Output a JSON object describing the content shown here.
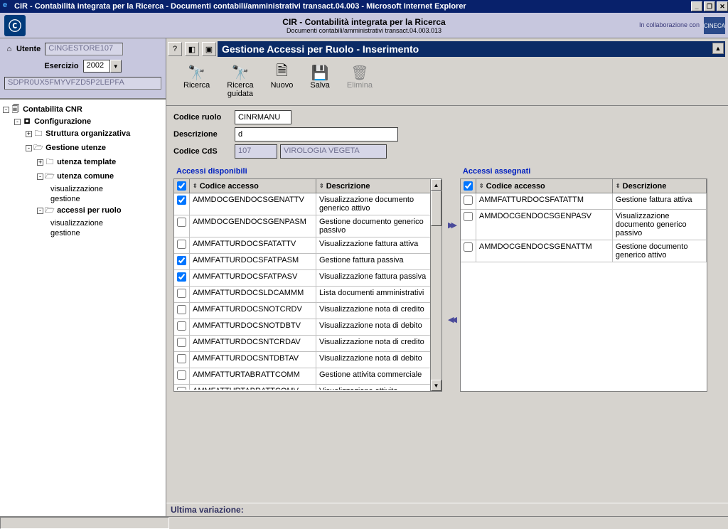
{
  "window": {
    "title": "CIR  -  Contabilità integrata per la Ricerca  -  Documenti contabili/amministrativi transact.04.003  -  Microsoft Internet Explorer"
  },
  "header": {
    "app_title": "CIR - Contabilità integrata per la Ricerca",
    "app_subtitle": "Documenti contabili/amministrativi transact.04.003.013",
    "collab": "In collaborazione con",
    "cineca": "CINECA"
  },
  "left": {
    "utente_label": "Utente",
    "utente_value": "CINGESTORE107",
    "esercizio_label": "Esercizio",
    "esercizio_value": "2002",
    "code_value": "SDPR0UX5FMYVFZD5P2LEPFA"
  },
  "tree": {
    "root": "Contabilita CNR",
    "n0": "Configurazione",
    "n01": "Struttura organizzativa",
    "n02": "Gestione utenze",
    "n021": "utenza template",
    "n022": "utenza comune",
    "n0221": "visualizzazione",
    "n0222": "gestione",
    "n023": "accessi per ruolo",
    "n0231": "visualizzazione",
    "n0232": "gestione"
  },
  "section": {
    "title": "Gestione Accessi per Ruolo - Inserimento"
  },
  "actions": {
    "ricerca": "Ricerca",
    "ricerca_guidata": "Ricerca\nguidata",
    "nuovo": "Nuovo",
    "salva": "Salva",
    "elimina": "Elimina"
  },
  "form": {
    "codice_ruolo_label": "Codice ruolo",
    "codice_ruolo_value": "CINRMANU",
    "descrizione_label": "Descrizione",
    "descrizione_value": "d",
    "codice_cds_label": "Codice CdS",
    "codice_cds_value": "107",
    "codice_cds_desc": "VIROLOGIA VEGETA"
  },
  "lists": {
    "disp_title": "Accessi disponibili",
    "asseg_title": "Accessi assegnati",
    "col_code": "Codice accesso",
    "col_desc": "Descrizione"
  },
  "disponibili": [
    {
      "chk": true,
      "code": "AMMDOCGENDOCSGENATTV",
      "desc": "Visualizzazione documento generico attivo"
    },
    {
      "chk": false,
      "code": "AMMDOCGENDOCSGENPASM",
      "desc": "Gestione documento generico passivo"
    },
    {
      "chk": false,
      "code": "AMMFATTURDOCSFATATTV",
      "desc": "Visualizzazione fattura attiva"
    },
    {
      "chk": true,
      "code": "AMMFATTURDOCSFATPASM",
      "desc": "Gestione fattura passiva"
    },
    {
      "chk": true,
      "code": "AMMFATTURDOCSFATPASV",
      "desc": "Visualizzazione fattura passiva"
    },
    {
      "chk": false,
      "code": "AMMFATTURDOCSLDCAMMM",
      "desc": "Lista documenti amministrativi"
    },
    {
      "chk": false,
      "code": "AMMFATTURDOCSNOTCRDV",
      "desc": "Visualizzazione nota di credito"
    },
    {
      "chk": false,
      "code": "AMMFATTURDOCSNOTDBTV",
      "desc": "Visualizzazione nota di debito"
    },
    {
      "chk": false,
      "code": "AMMFATTURDOCSNTCRDAV",
      "desc": "Visualizzazione nota di credito"
    },
    {
      "chk": false,
      "code": "AMMFATTURDOCSNTDBTAV",
      "desc": "Visualizzazione nota di debito"
    },
    {
      "chk": false,
      "code": "AMMFATTURTABRATTCOMM",
      "desc": "Gestione attivita commerciale"
    },
    {
      "chk": false,
      "code": "AMMFATTURTABRATTCOMV",
      "desc": "Visualizzazione attivita"
    }
  ],
  "assegnati": [
    {
      "chk": false,
      "code": "AMMFATTURDOCSFATATTM",
      "desc": "Gestione fattura attiva"
    },
    {
      "chk": false,
      "code": "AMMDOCGENDOCSGENPASV",
      "desc": "Visualizzazione documento generico passivo"
    },
    {
      "chk": false,
      "code": "AMMDOCGENDOCSGENATTM",
      "desc": "Gestione documento generico attivo"
    }
  ],
  "footer": {
    "ultima": "Ultima variazione:"
  }
}
